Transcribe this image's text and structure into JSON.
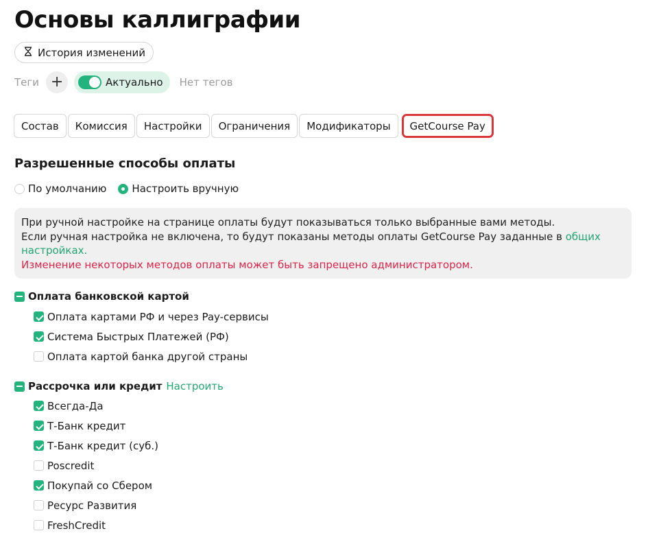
{
  "page": {
    "title": "Основы каллиграфии"
  },
  "history": {
    "label": "История изменений",
    "icon": "hourglass-icon"
  },
  "tags": {
    "label": "Теги",
    "add": "+",
    "status": "Актуально",
    "empty": "Нет тегов"
  },
  "tabs": [
    {
      "label": "Состав"
    },
    {
      "label": "Комиссия"
    },
    {
      "label": "Настройки"
    },
    {
      "label": "Ограничения"
    },
    {
      "label": "Модификаторы"
    },
    {
      "label": "GetCourse Pay",
      "active": true
    }
  ],
  "payment": {
    "title": "Разрешенные способы оплаты",
    "options": [
      {
        "label": "По умолчанию",
        "selected": false
      },
      {
        "label": "Настроить вручную",
        "selected": true
      }
    ],
    "info": {
      "line1": "При ручной настройке на странице оплаты будут показываться только выбранные вами методы.",
      "line2": "Если ручная настройка не включена, то будут показаны методы оплаты GetCourse Pay заданные в ",
      "link": "общих настройках.",
      "warning": "Изменение некоторых методов оплаты может быть запрещено администратором."
    },
    "groups": [
      {
        "title": "Оплата банковской картой",
        "items": [
          {
            "label": "Оплата картами РФ и через Pay-сервисы",
            "checked": true
          },
          {
            "label": "Система Быстрых Платежей (РФ)",
            "checked": true
          },
          {
            "label": "Оплата картой банка другой страны",
            "checked": false
          }
        ]
      },
      {
        "title": "Рассрочка или кредит",
        "config_link": "Настроить",
        "items": [
          {
            "label": "Всегда-Да",
            "checked": true
          },
          {
            "label": "Т-Банк кредит",
            "checked": true
          },
          {
            "label": "Т-Банк кредит (суб.)",
            "checked": true
          },
          {
            "label": "Poscredit",
            "checked": false
          },
          {
            "label": "Покупай со Сбером",
            "checked": true
          },
          {
            "label": "Ресурс Развития",
            "checked": false
          },
          {
            "label": "FreshCredit",
            "checked": false
          }
        ]
      }
    ]
  },
  "colors": {
    "accent": "#23b47e",
    "link": "#23a574",
    "warning": "#d7264b",
    "active_tab_border": "#d9383a"
  }
}
